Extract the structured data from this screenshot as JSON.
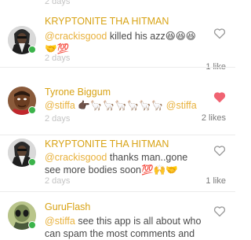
{
  "top_stub": {
    "timestamp": "2 days"
  },
  "comments": [
    {
      "username": "KRYPTONITE THA HITMAN",
      "mention": "@crackisgood",
      "text": " killed his azz😆😆😆🤝💯",
      "timestamp": "2 days",
      "likes_label": "1 like",
      "liked": false,
      "avatar_icon": "hooded-figure-avatar-icon",
      "online": true
    },
    {
      "username": "Tyrone Biggum",
      "mention": "@stiffa",
      "text": " 👉🏿🦙🦙🦙🦙🦙🦙 ",
      "mention_tail": "@stiffa",
      "timestamp": "2 days",
      "likes_label": "2 likes",
      "liked": true,
      "avatar_icon": "man-portrait-avatar-icon",
      "online": true
    },
    {
      "username": "KRYPTONITE THA HITMAN",
      "mention": "@crackisgood",
      "text": " thanks man..gone see more  bodies  soon💯🙌🤝",
      "timestamp": "2 days",
      "likes_label": "1 like",
      "liked": false,
      "avatar_icon": "hooded-figure-avatar-icon",
      "online": true
    },
    {
      "username": "GuruFlash",
      "mention": "@stiffa",
      "text": " see this app is all about who can spam the most comments and",
      "liked": false,
      "avatar_icon": "alien-avatar-icon",
      "online": true
    }
  ],
  "colors": {
    "username": "#d8a315",
    "mention": "#e8b13c",
    "heart_active": "#f06372",
    "heart_inactive": "#9a9a9a",
    "online": "#3bb34a"
  }
}
